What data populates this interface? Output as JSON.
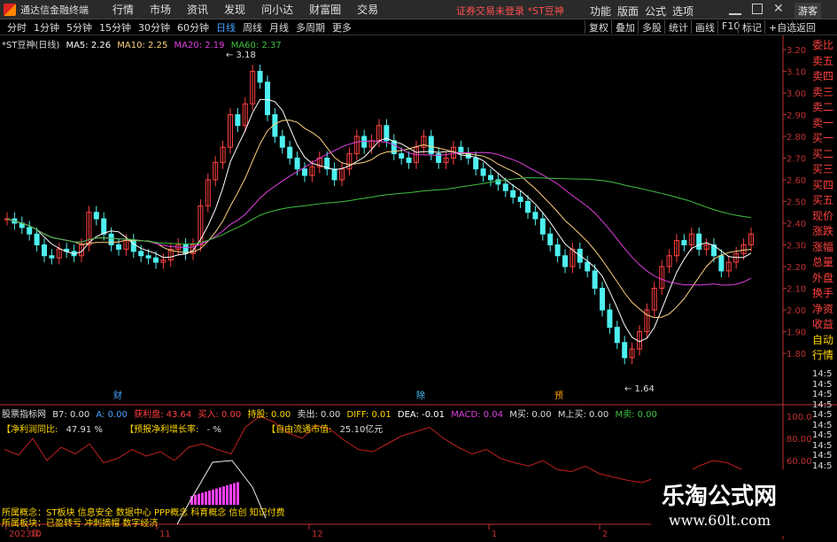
{
  "titlebar": {
    "app_title": "通达信金融终端",
    "menus": [
      "行情",
      "市场",
      "资讯",
      "发现",
      "问小达",
      "财富圈",
      "交易"
    ],
    "notice": "证券交易未登录 *ST豆神",
    "right_menus": [
      "功能",
      "版面",
      "公式",
      "选项"
    ],
    "guest": "游客"
  },
  "periods": [
    "分时",
    "1分钟",
    "5分钟",
    "15分钟",
    "30分钟",
    "60分钟",
    "日线",
    "周线",
    "月线",
    "多周期",
    "更多"
  ],
  "active_period": "日线",
  "toolbar": [
    "复权",
    "叠加",
    "多股",
    "统计",
    "画线",
    "F10",
    "标记",
    "+自选",
    "返回"
  ],
  "ma_legend": {
    "stock": "*ST豆神(日线)",
    "ma5": "MA5: 2.26",
    "ma10": "MA10: 2.25",
    "ma20": "MA20: 2.19",
    "ma60": "MA60: 2.37"
  },
  "price_axis": [
    "3.20",
    "3.10",
    "3.00",
    "2.90",
    "2.80",
    "2.70",
    "2.60",
    "2.50",
    "2.40",
    "2.30",
    "2.20",
    "2.10",
    "2.00",
    "1.90",
    "1.80"
  ],
  "annotations": {
    "high": "3.18",
    "low": "1.64",
    "event1": "财",
    "event2": "除",
    "event3": "预"
  },
  "side_labels": [
    "委比",
    "卖五",
    "卖四",
    "卖三",
    "卖二",
    "卖一",
    "买一",
    "买二",
    "买三",
    "买四",
    "买五",
    "现价",
    "涨跌",
    "涨幅",
    "总量",
    "外盘",
    "换手",
    "净资",
    "收益",
    "自动",
    "行情"
  ],
  "side_times": [
    "14:5",
    "14:5",
    "14:5",
    "14:5",
    "14:5",
    "14:5",
    "14:5",
    "14:5",
    "14:5",
    "14:5",
    "14:5",
    "14:5",
    "14:5",
    "14:5",
    "14:5"
  ],
  "indicator": {
    "name": "股票指标网",
    "b7": "B7: 0.00",
    "a": "A: 0.00",
    "profit": "获利盘: 43.64",
    "buy": "买入: 0.00",
    "hold": "持股: 0.00",
    "sell": "卖出: 0.00",
    "diff": "DIFF: 0.01",
    "dea": "DEA: -0.01",
    "macd": "MACD: 0.04",
    "mbuy": "M买: 0.00",
    "mup": "M上买: 0.00",
    "msell": "M卖: 0.00"
  },
  "fin": {
    "net_profit_label": "【净利润同比:",
    "net_profit": "47.91 %",
    "forecast_label": "【预报净利增长率:",
    "forecast": "- %",
    "float_cap_label": "【自由流通市值:",
    "float_cap": "25.10亿元"
  },
  "ind_axis": [
    "100.0",
    "80.00",
    "60.00"
  ],
  "concepts": {
    "line1": "所属概念：ST板块 信息安全 数据中心 PPP概念 科育概念 信创 知识付费",
    "line2": "所属板块：已盈转亏 冲刺摘帽 数字经济"
  },
  "date_axis": [
    "2023年",
    "10",
    "11",
    "12",
    "1",
    "2"
  ],
  "watermark": {
    "title": "乐淘公式网",
    "url": "www.60lt.com"
  },
  "colors": {
    "up": "#ff4040",
    "down": "#4ef0f0",
    "ma5": "#ffffff",
    "ma10": "#ffd27f",
    "ma20": "#e040e0",
    "ma60": "#40c040",
    "axis": "#c03030"
  }
}
